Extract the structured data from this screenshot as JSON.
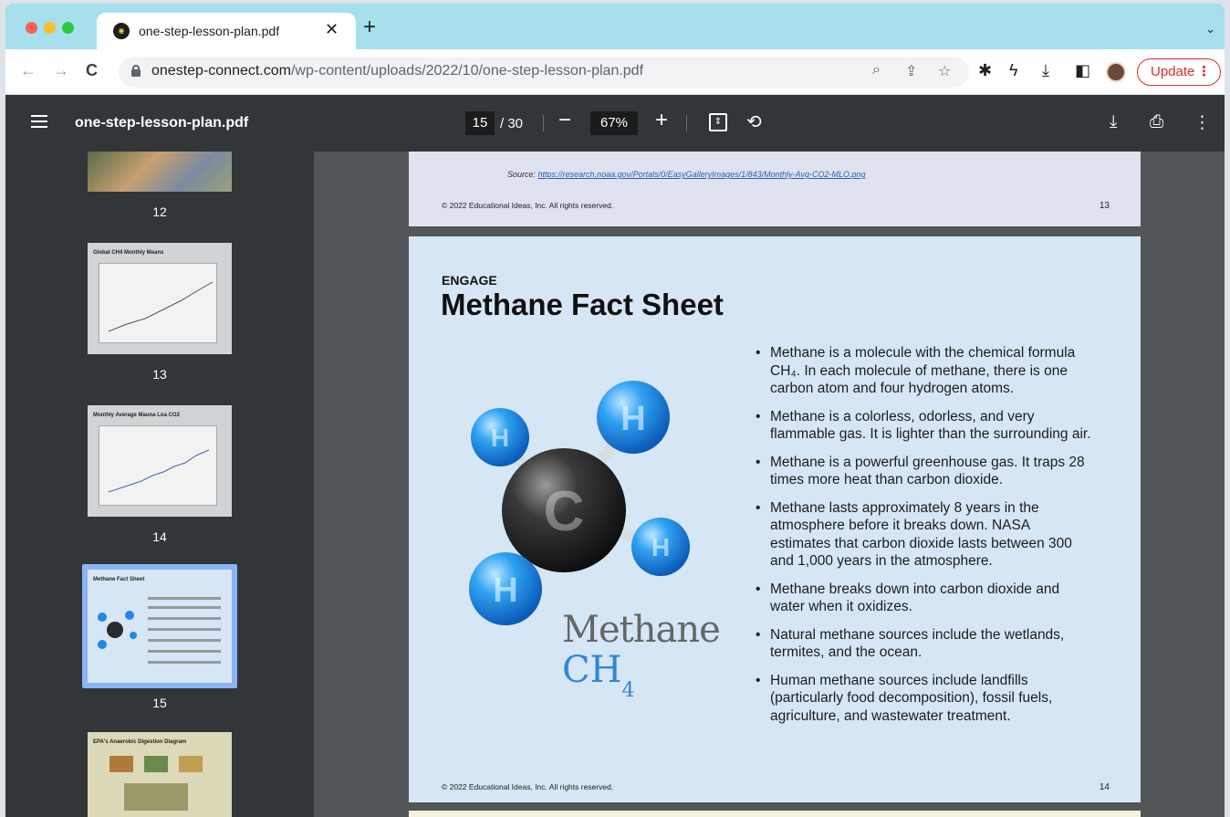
{
  "browser": {
    "tab_title": "one-step-lesson-plan.pdf",
    "tab_close": "✕",
    "new_tab": "+",
    "tab_menu": "⌄",
    "url_host": "onestep-connect.com",
    "url_path": "/wp-content/uploads/2022/10/one-step-lesson-plan.pdf",
    "update_label": "Update"
  },
  "pdf": {
    "title": "one-step-lesson-plan.pdf",
    "current_page": "15",
    "total_pages": "/ 30",
    "zoom": "67%"
  },
  "sidebar": {
    "thumbs": [
      {
        "label": "12"
      },
      {
        "label": "13",
        "heading": "Global CH4 Monthly Means"
      },
      {
        "label": "14",
        "heading": "Monthly Average Mauna Loa CO2"
      },
      {
        "label": "15",
        "heading": "Methane Fact Sheet"
      },
      {
        "heading": "EPA's Anaerobic Digestion Diagram"
      }
    ]
  },
  "previous_page": {
    "source_prefix": "Source: ",
    "source_link": "https://research.noaa.gov/Portals/0/EasyGalleryImages/1/843/Monthly-Avg-CO2-MLO.png",
    "copyright": "© 2022 Educational Ideas, Inc. All rights reserved.",
    "page_number": "13"
  },
  "page": {
    "kicker": "ENGAGE",
    "title": "Methane Fact Sheet",
    "molecule_word": "Methane",
    "formula_main": "CH",
    "formula_sub": "4",
    "atom_carbon": "C",
    "atom_hydrogen": "H",
    "bullets": [
      "Methane is a molecule with the chemical formula CH₄. In each molecule of methane, there is one carbon atom and four hydrogen atoms.",
      "Methane is a colorless, odorless, and very flammable gas. It is lighter than the surrounding air.",
      "Methane is a powerful greenhouse gas. It traps 28 times more heat than carbon dioxide.",
      "Methane lasts approximately 8 years in the atmosphere before it breaks down. NASA estimates that carbon dioxide lasts between 300 and 1,000 years in the atmosphere.",
      "Methane breaks down into carbon dioxide and water when it oxidizes.",
      "Natural methane sources include the wetlands, termites, and the ocean.",
      "Human methane sources include landfills (particularly food decomposition), fossil fuels, agriculture, and wastewater treatment."
    ],
    "copyright": "© 2022 Educational Ideas, Inc. All rights reserved.",
    "page_number": "14"
  },
  "colors": {
    "tabstrip": "#a6e0ec",
    "update_red": "#d93025",
    "hydrogen_blue": "#1e88e5",
    "carbon_dark": "#2b2b2b",
    "page_bg": "#d6e6f4"
  }
}
